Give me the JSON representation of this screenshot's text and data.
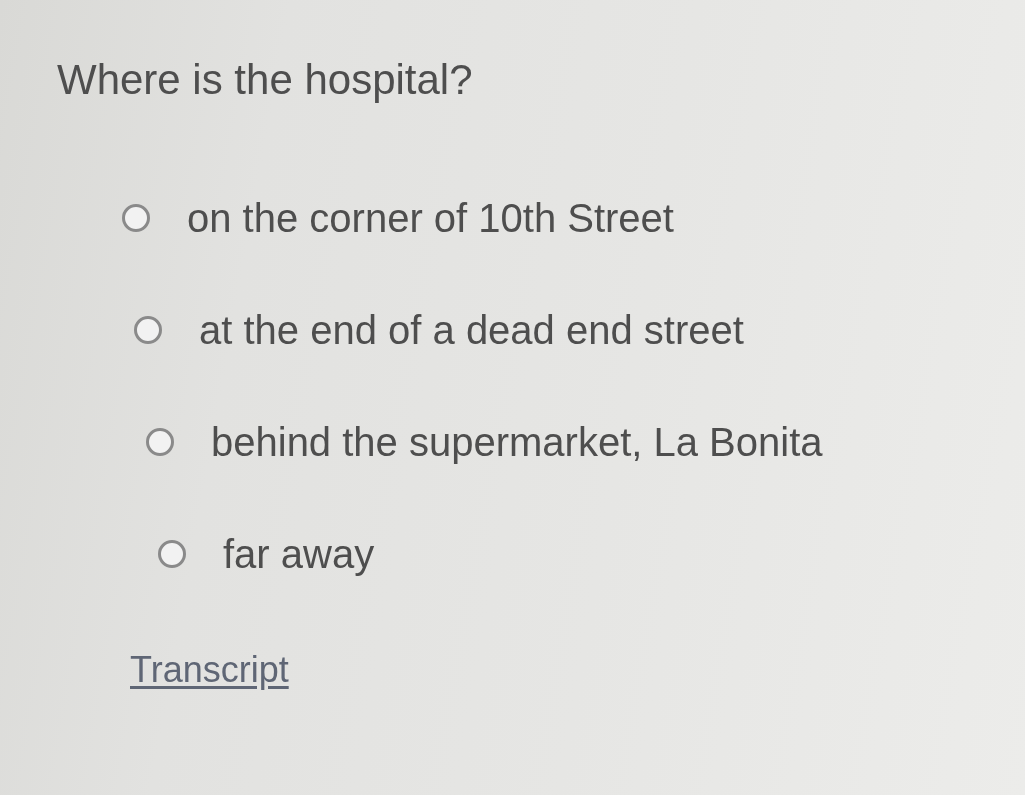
{
  "question": "Where is the hospital?",
  "options": [
    {
      "label": "on the corner of 10th Street",
      "selected": false
    },
    {
      "label": "at the end of a dead end street",
      "selected": false
    },
    {
      "label": "behind the supermarket, La Bonita",
      "selected": false
    },
    {
      "label": "far away",
      "selected": false
    }
  ],
  "link": "Transcript"
}
